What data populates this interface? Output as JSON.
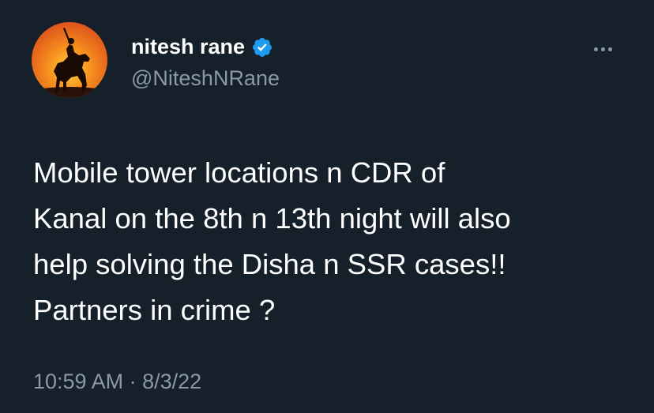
{
  "author": {
    "display_name": "nitesh rane",
    "handle": "@NiteshNRane",
    "verified": true,
    "avatar_icon": "warrior-on-horse-silhouette-icon"
  },
  "tweet": {
    "lines": [
      "Mobile tower locations n CDR of",
      "Kanal on the 8th n 13th night will also",
      "help solving the Disha n SSR cases!!",
      "Partners in crime ?"
    ],
    "time": "10:59 AM",
    "separator": "·",
    "date": "8/3/22"
  },
  "colors": {
    "background": "#15202b",
    "text": "#ffffff",
    "secondary_text": "#8b98a5",
    "verified_badge": "#1d9bf0"
  },
  "icons": {
    "more": "more-horizontal-icon",
    "verified": "verified-badge-icon"
  }
}
